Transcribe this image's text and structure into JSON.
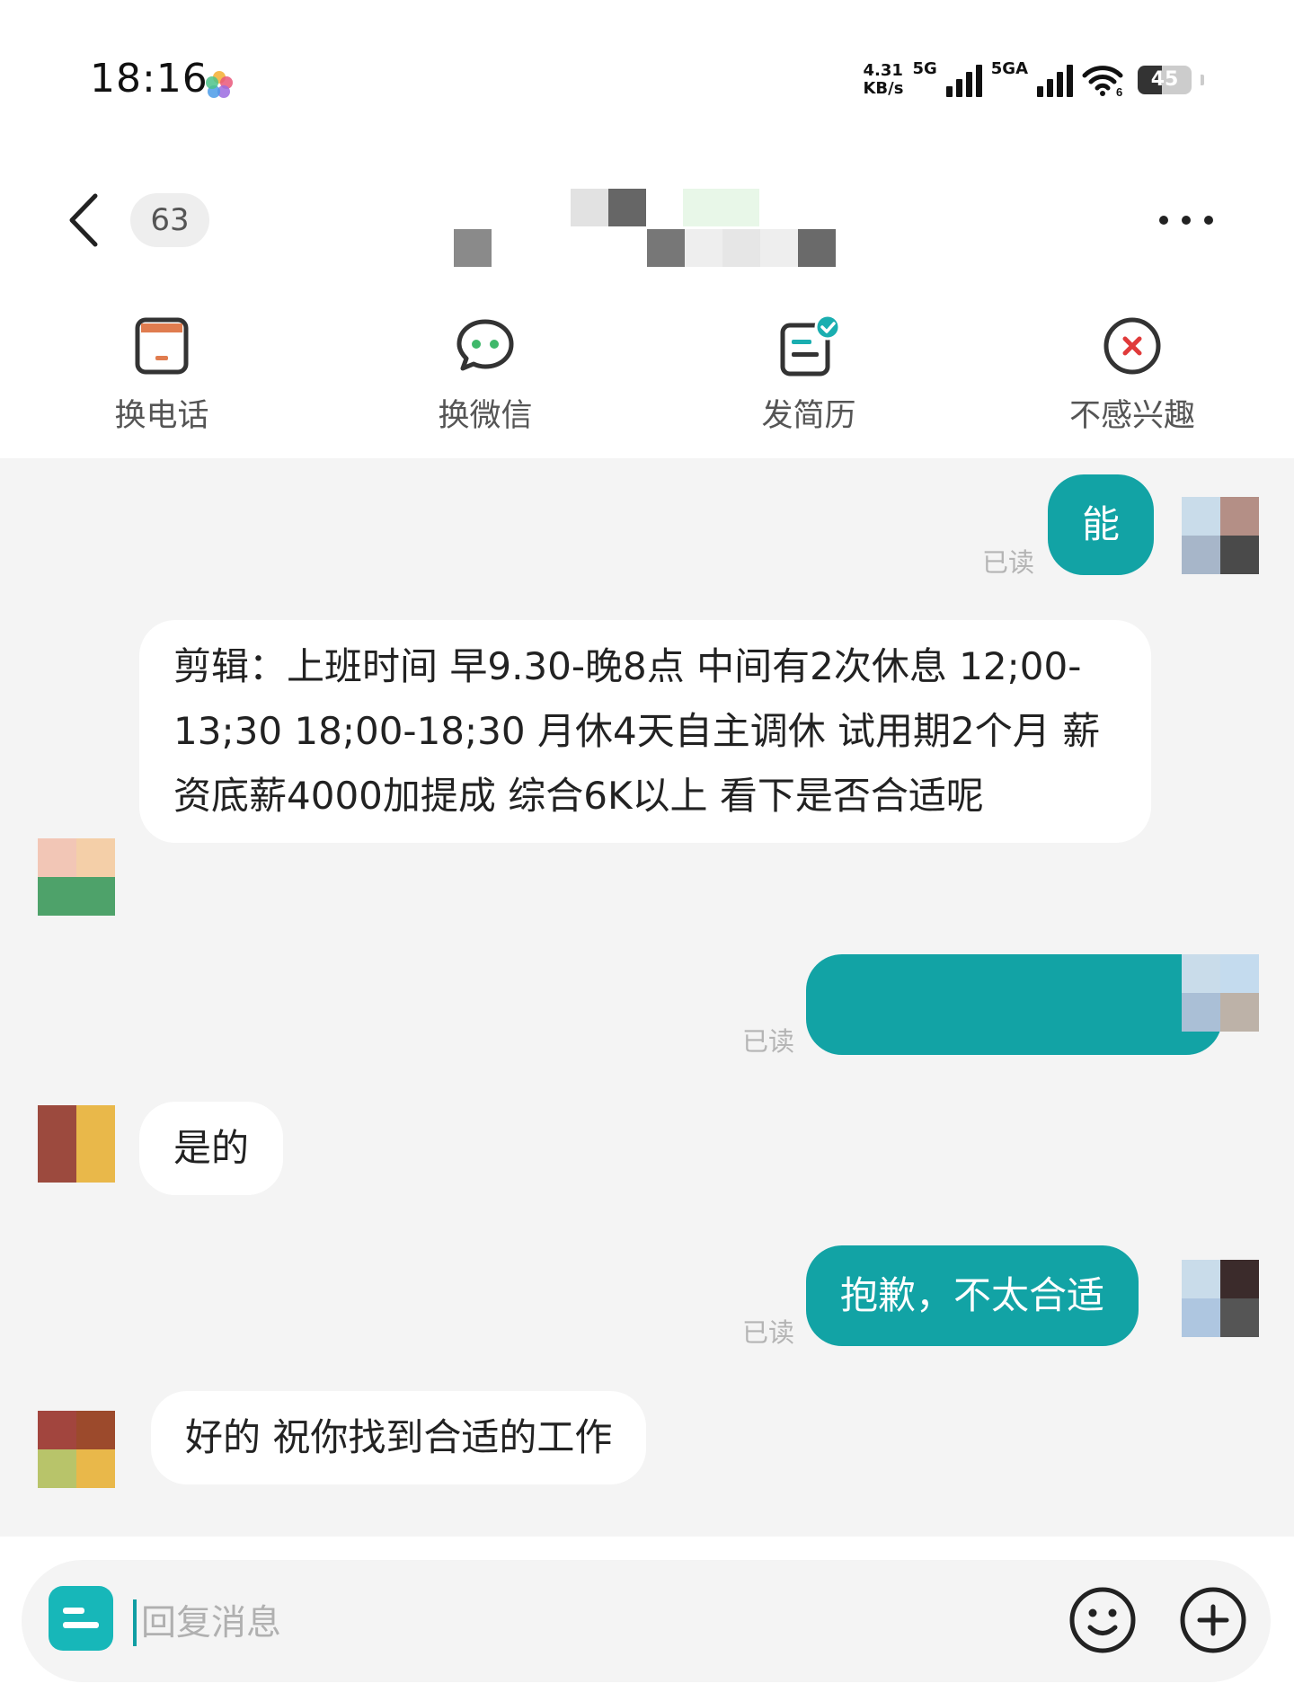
{
  "status_bar": {
    "time": "18:16",
    "net_speed": "4.31",
    "net_speed_unit": "KB/s",
    "sim1_label": "5G",
    "sim2_label": "5GA",
    "wifi_label": "6",
    "battery": "45",
    "battery_level": 0.45
  },
  "header": {
    "unread_count": "63",
    "back_icon": "chevron-left-icon",
    "more_icon": "more-horizontal-icon"
  },
  "actions": [
    {
      "label": "换电话",
      "icon": "phone-card-icon",
      "color": "#e07c4f"
    },
    {
      "label": "换微信",
      "icon": "wechat-bubble-icon",
      "color": "#3fb86a"
    },
    {
      "label": "发简历",
      "icon": "resume-check-icon",
      "color": "#1aaeb0"
    },
    {
      "label": "不感兴趣",
      "icon": "close-circle-icon",
      "color": "#e03a3a"
    }
  ],
  "messages": [
    {
      "side": "out",
      "text": "能",
      "status": "已读"
    },
    {
      "side": "in",
      "text": "剪辑：上班时间 早9.30-晚8点 中间有2次休息 12;00-13;30  18;00-18;30  月休4天自主调休 试用期2个月 薪资底薪4000加提成 综合6K以上  看下是否合适呢"
    },
    {
      "side": "out",
      "text": "",
      "status": "已读"
    },
    {
      "side": "in",
      "text": "是的"
    },
    {
      "side": "out",
      "text": "抱歉，不太合适",
      "status": "已读"
    },
    {
      "side": "in",
      "text": "好的 祝你找到合适的工作"
    }
  ],
  "input": {
    "placeholder": "回复消息",
    "emoji_icon": "smiley-icon",
    "plus_icon": "plus-circle-icon",
    "quick_icon": "quick-reply-icon"
  },
  "colors": {
    "accent": "#12a3a5",
    "chat_bg": "#f4f4f4"
  }
}
